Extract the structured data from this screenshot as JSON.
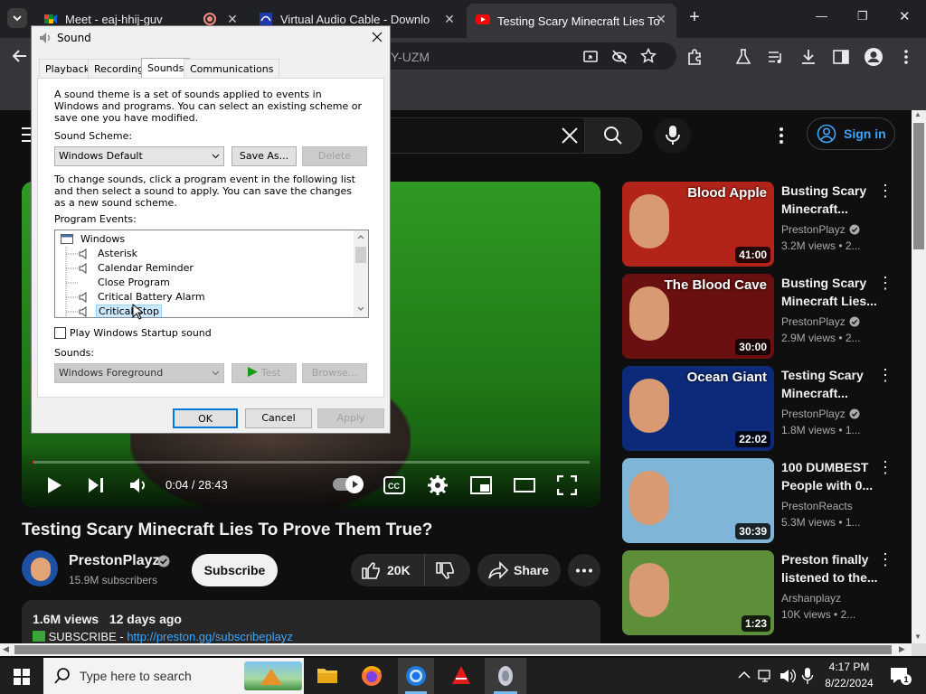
{
  "browser": {
    "tabs": [
      {
        "title": "Meet - eaj-hhij-guv",
        "active": false
      },
      {
        "title": "Virtual Audio Cable - Downlo",
        "active": false
      },
      {
        "title": "Testing Scary Minecraft Lies To",
        "active": true
      }
    ],
    "url_fragment": "Y-UZM",
    "new_tab": "+",
    "window_controls": {
      "minimize": "—",
      "restore": "❐",
      "close": "✕"
    }
  },
  "youtube": {
    "sign_in": "Sign in",
    "video": {
      "title": "Testing Scary Minecraft Lies To Prove Them True?",
      "time": "0:04 / 28:43",
      "progress": 0.0023,
      "channel": "PrestonPlayz",
      "subscribers": "15.9M subscribers",
      "subscribe": "Subscribe",
      "likes": "20K",
      "share": "Share",
      "views": "1.6M views",
      "age": "12 days ago",
      "desc_prefix": "SUBSCRIBE - ",
      "desc_link": "http://preston.gg/subscribeplayz"
    },
    "related": [
      {
        "title": "Busting Scary Minecraft...",
        "channel": "PrestonPlayz",
        "verified": true,
        "meta": "3.2M views • 2...",
        "duration": "41:00",
        "thumb_text": "Blood Apple",
        "thumb_bg": "#b2241a"
      },
      {
        "title": "Busting Scary Minecraft Lies...",
        "channel": "PrestonPlayz",
        "verified": true,
        "meta": "2.9M views • 2...",
        "duration": "30:00",
        "thumb_text": "The Blood Cave",
        "thumb_bg": "#6b1010"
      },
      {
        "title": "Testing Scary Minecraft...",
        "channel": "PrestonPlayz",
        "verified": true,
        "meta": "1.8M views • 1...",
        "duration": "22:02",
        "thumb_text": "Ocean Giant",
        "thumb_bg": "#0d2a7a"
      },
      {
        "title": "100 DUMBEST People with 0...",
        "channel": "PrestonReacts",
        "verified": false,
        "meta": "5.3M views • 1...",
        "duration": "30:39",
        "thumb_text": "",
        "thumb_bg": "#7fb6d8"
      },
      {
        "title": "Preston finally listened to the...",
        "channel": "Arshanplayz",
        "verified": false,
        "meta": "10K views • 2...",
        "duration": "1:23",
        "thumb_text": "",
        "thumb_bg": "#5d8f3a"
      }
    ]
  },
  "dialog": {
    "title": "Sound",
    "tabs": [
      "Playback",
      "Recording",
      "Sounds",
      "Communications"
    ],
    "selected_tab": "Sounds",
    "intro": "A sound theme is a set of sounds applied to events in Windows and programs.  You can select an existing scheme or save one you have modified.",
    "scheme_label": "Sound Scheme:",
    "scheme_value": "Windows Default",
    "save_as": "Save As...",
    "delete": "Delete",
    "change_text": "To change sounds, click a program event in the following list and then select a sound to apply.  You can save the changes as a new sound scheme.",
    "events_label": "Program Events:",
    "events": [
      {
        "name": "Windows",
        "group": true,
        "sound": false
      },
      {
        "name": "Asterisk",
        "group": false,
        "sound": true
      },
      {
        "name": "Calendar Reminder",
        "group": false,
        "sound": true
      },
      {
        "name": "Close Program",
        "group": false,
        "sound": false
      },
      {
        "name": "Critical Battery Alarm",
        "group": false,
        "sound": true
      },
      {
        "name": "Critical Stop",
        "group": false,
        "sound": true,
        "selected": true
      }
    ],
    "startup_label": "Play Windows Startup sound",
    "startup_checked": false,
    "sounds_label": "Sounds:",
    "sounds_value": "Windows Foreground",
    "test": "Test",
    "browse": "Browse...",
    "ok": "OK",
    "cancel": "Cancel",
    "apply": "Apply"
  },
  "taskbar": {
    "search_placeholder": "Type here to search",
    "time": "4:17 PM",
    "date": "8/22/2024",
    "notifications": "1"
  }
}
